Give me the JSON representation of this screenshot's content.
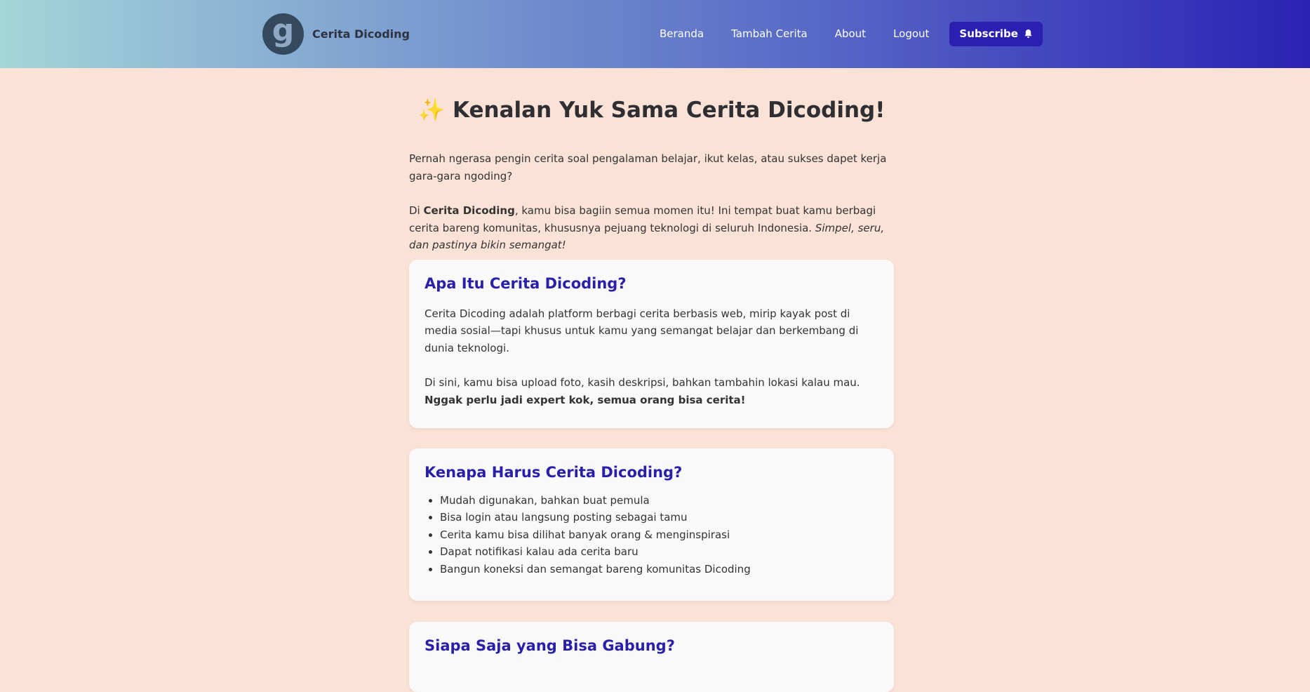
{
  "header": {
    "brand_name": "Cerita Dicoding",
    "logo_glyph": "g",
    "nav": [
      "Beranda",
      "Tambah Cerita",
      "About",
      "Logout"
    ],
    "subscribe_label": "Subscribe"
  },
  "main": {
    "title_emoji": "✨",
    "title": "Kenalan Yuk Sama  Cerita Dicoding!",
    "intro": {
      "p1": "Pernah ngerasa pengin cerita soal pengalaman belajar, ikut kelas, atau sukses dapet kerja gara-gara ngoding?",
      "p2_prefix": "Di ",
      "p2_bold": "Cerita Dicoding",
      "p2_middle": ", kamu bisa bagiin semua momen itu! Ini tempat buat kamu berbagi cerita bareng komunitas, khususnya pejuang teknologi di seluruh Indonesia. ",
      "p2_italic": "Simpel, seru, dan pastinya bikin semangat!"
    },
    "sections": [
      {
        "title": "Apa Itu Cerita Dicoding?",
        "p1": "Cerita Dicoding adalah platform berbagi cerita berbasis web, mirip kayak post di media sosial—tapi khusus untuk kamu yang semangat belajar dan berkembang di dunia teknologi.",
        "p2": "Di sini, kamu bisa upload foto, kasih deskripsi, bahkan tambahin lokasi kalau mau. ",
        "p2_bold": "Nggak perlu jadi expert kok, semua orang bisa cerita!"
      },
      {
        "title": "Kenapa Harus Cerita Dicoding?",
        "items": [
          "Mudah digunakan, bahkan buat pemula",
          "Bisa login atau langsung posting sebagai tamu",
          "Cerita kamu bisa dilihat banyak orang & menginspirasi",
          "Dapat notifikasi kalau ada cerita baru",
          "Bangun koneksi dan semangat bareng komunitas Dicoding"
        ]
      },
      {
        "title": "Siapa Saja yang Bisa Gabung?"
      }
    ]
  },
  "colors": {
    "background": "#fbe2d6",
    "accent": "#2a1fb0",
    "heading": "#2a1fa8"
  }
}
